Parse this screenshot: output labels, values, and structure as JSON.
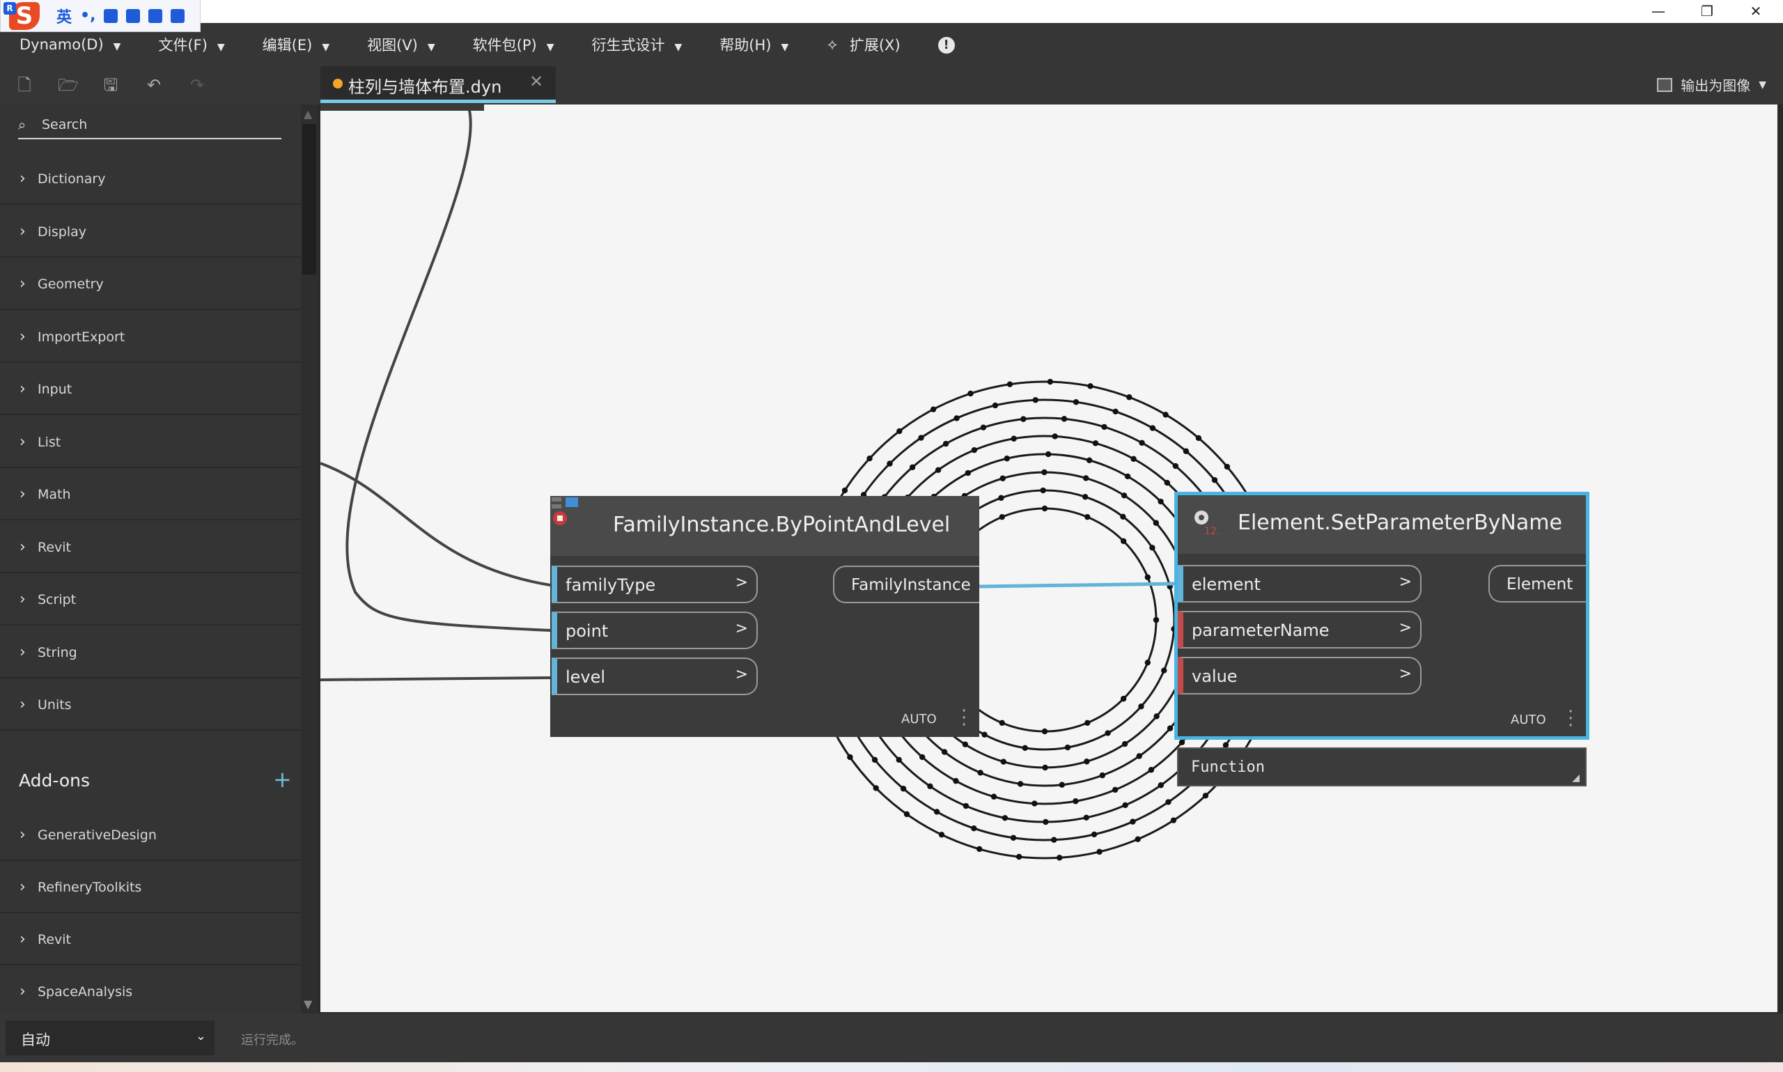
{
  "ime": {
    "lang": "英",
    "punct": "•,",
    "logo_r": "R",
    "logo_s": "S"
  },
  "window": {
    "minimize": "—",
    "restore": "❐",
    "close": "✕"
  },
  "menu": {
    "items": [
      {
        "label": "Dynamo(D)"
      },
      {
        "label": "文件(F)"
      },
      {
        "label": "编辑(E)"
      },
      {
        "label": "视图(V)"
      },
      {
        "label": "软件包(P)"
      },
      {
        "label": "衍生式设计"
      },
      {
        "label": "帮助(H)"
      },
      {
        "label": "扩展(X)"
      }
    ],
    "caret": "▼",
    "pin_icon": "✧",
    "warning_icon": "!"
  },
  "toolbar": {
    "icons": [
      "new-file-icon",
      "open-folder-icon",
      "save-icon",
      "undo-icon",
      "redo-icon"
    ],
    "export_label": "输出为图像",
    "export_caret": "▼"
  },
  "tab": {
    "name": "柱列与墙体布置.dyn",
    "close": "✕",
    "dirty_color": "#f5a623"
  },
  "sidebar": {
    "search_placeholder": "Search",
    "search_icon": "⌕",
    "chevron": "›",
    "categories": [
      {
        "label": "Dictionary"
      },
      {
        "label": "Display"
      },
      {
        "label": "Geometry"
      },
      {
        "label": "ImportExport"
      },
      {
        "label": "Input"
      },
      {
        "label": "List"
      },
      {
        "label": "Math"
      },
      {
        "label": "Revit"
      },
      {
        "label": "Script"
      },
      {
        "label": "String"
      },
      {
        "label": "Units"
      }
    ],
    "addons_title": "Add-ons",
    "addons_plus": "+",
    "addons": [
      {
        "label": "GenerativeDesign"
      },
      {
        "label": "RefineryToolkits"
      },
      {
        "label": "Revit"
      },
      {
        "label": "SpaceAnalysis"
      }
    ]
  },
  "nodes": {
    "family_instance": {
      "title": "FamilyInstance.ByPointAndLevel",
      "inputs": [
        {
          "label": "familyType"
        },
        {
          "label": "point"
        },
        {
          "label": "level"
        }
      ],
      "output": "FamilyInstance",
      "lacing": "AUTO",
      "port_arrow": ">"
    },
    "set_parameter": {
      "title": "Element.SetParameterByName",
      "inputs": [
        {
          "label": "element"
        },
        {
          "label": "parameterName"
        },
        {
          "label": "value"
        }
      ],
      "output": "Element",
      "lacing": "AUTO",
      "port_arrow": ">",
      "selected_color": "#49b3e1"
    }
  },
  "lacing_tooltip": {
    "value": "Function",
    "resize": "◢"
  },
  "view_controls": {
    "geometry_view": "⌂",
    "graph_view": "⇆",
    "zoom_fit": "⛶",
    "zoom_in": "+",
    "zoom_out": "−",
    "pan": "✥"
  },
  "status": {
    "run_mode": "自动",
    "run_mode_caret": "⌄",
    "message": "运行完成。"
  },
  "colors": {
    "accent": "#78cce6",
    "port_blue": "#62b4d8",
    "port_red": "#c44a4a",
    "canvas": "#f5f5f5",
    "chrome": "#363636"
  }
}
